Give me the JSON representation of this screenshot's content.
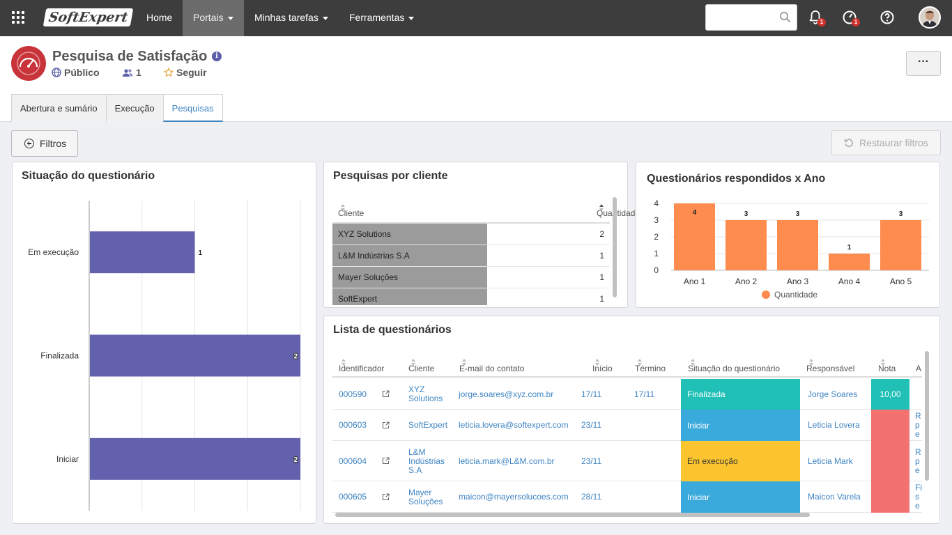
{
  "nav": {
    "logo": "SoftExpert",
    "items": [
      {
        "label": "Home",
        "active": false,
        "dropdown": false
      },
      {
        "label": "Portais",
        "active": true,
        "dropdown": true
      },
      {
        "label": "Minhas tarefas",
        "active": false,
        "dropdown": true
      },
      {
        "label": "Ferramentas",
        "active": false,
        "dropdown": true
      }
    ],
    "search_value": "",
    "notifications_badge": "1",
    "tasks_badge": "1"
  },
  "header": {
    "title": "Pesquisa de Satisfação",
    "visibility": "Público",
    "members": "1",
    "follow": "Seguir",
    "more": "···"
  },
  "tabs": [
    {
      "label": "Abertura e sumário",
      "active": false
    },
    {
      "label": "Execução",
      "active": false
    },
    {
      "label": "Pesquisas",
      "active": true
    }
  ],
  "toolbar": {
    "filters_label": "Filtros",
    "restore_label": "Restaurar filtros"
  },
  "status_panel": {
    "title": "Situação do questionário",
    "chart_data": {
      "type": "bar",
      "orientation": "horizontal",
      "categories": [
        "Em execução",
        "Finalizada",
        "Iniciar"
      ],
      "values": [
        1,
        2,
        2
      ],
      "xlim": [
        0,
        2
      ],
      "color": "#6361ad",
      "grid": true
    }
  },
  "client_panel": {
    "title": "Pesquisas por cliente",
    "columns": [
      "Cliente",
      "Quantidade"
    ],
    "rows": [
      {
        "client": "XYZ Solutions",
        "qty": "2"
      },
      {
        "client": "L&M Indústrias S.A",
        "qty": "1"
      },
      {
        "client": "Mayer Soluções",
        "qty": "1"
      },
      {
        "client": "SoftExpert",
        "qty": "1"
      }
    ]
  },
  "year_panel": {
    "title": "Questionários respondidos x Ano",
    "chart_data": {
      "type": "bar",
      "categories": [
        "Ano 1",
        "Ano 2",
        "Ano 3",
        "Ano 4",
        "Ano 5"
      ],
      "series": [
        {
          "name": "Quantidade",
          "values": [
            4,
            3,
            3,
            1,
            3
          ]
        }
      ],
      "ylim": [
        0,
        4
      ],
      "yticks": [
        0,
        1,
        2,
        3,
        4
      ],
      "color": "#fd8c4e",
      "legend": "bottom",
      "grid": true
    }
  },
  "list_panel": {
    "title": "Lista de questionários",
    "columns": [
      "Identificador",
      "Cliente",
      "E-mail do contato",
      "Início",
      "Término",
      "Situação do questionário",
      "Responsável",
      "Nota",
      "A"
    ],
    "rows": [
      {
        "id": "000590",
        "client": "XYZ Solutions",
        "email": "jorge.soares@xyz.com.br",
        "start": "17/11",
        "end": "17/11",
        "status": "Finalizada",
        "status_color": "#20c0b6",
        "owner": "Jorge Soares",
        "grade": "10,00",
        "grade_color": "#20c0b6",
        "extra": ""
      },
      {
        "id": "000603",
        "client": "SoftExpert",
        "email": "leticia.lovera@softexpert.com",
        "start": "23/11",
        "end": "",
        "status": "Iniciar",
        "status_color": "#3aa9dc",
        "owner": "Leticia Lovera",
        "grade": "",
        "grade_color": "#f2726f",
        "extra": "R pe"
      },
      {
        "id": "000604",
        "client": "L&M Indústrias S.A",
        "email": "leticia.mark@L&M.com.br",
        "start": "23/11",
        "end": "",
        "status": "Em execução",
        "status_color": "#fcc52f",
        "owner": "Leticia Mark",
        "grade": "",
        "grade_color": "#f2726f",
        "extra": "R pe"
      },
      {
        "id": "000605",
        "client": "Mayer Soluções",
        "email": "maicon@mayersolucoes.com",
        "start": "28/11",
        "end": "",
        "status": "Iniciar",
        "status_color": "#3aa9dc",
        "owner": "Maicon Varela",
        "grade": "",
        "grade_color": "#f2726f",
        "extra": "Fi se"
      }
    ]
  }
}
